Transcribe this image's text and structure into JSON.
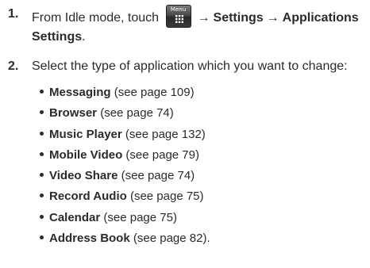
{
  "steps": [
    {
      "number": "1.",
      "prefix": "From Idle mode, touch",
      "menu_key_label": "Menu",
      "arrow": "→",
      "path": [
        "Settings",
        "Applications Settings"
      ],
      "suffix": "."
    },
    {
      "number": "2.",
      "text": "Select the type of application which you want to change:"
    }
  ],
  "applications": [
    {
      "name": "Messaging",
      "ref": "(see page 109)",
      "end": ""
    },
    {
      "name": "Browser",
      "ref": "(see page 74)",
      "end": ""
    },
    {
      "name": "Music Player",
      "ref": "(see page 132)",
      "end": ""
    },
    {
      "name": "Mobile Video",
      "ref": "(see page 79)",
      "end": ""
    },
    {
      "name": "Video Share",
      "ref": "(see page 74)",
      "end": ""
    },
    {
      "name": "Record Audio",
      "ref": "(see page 75)",
      "end": ""
    },
    {
      "name": "Calendar",
      "ref": "(see page 75)",
      "end": ""
    },
    {
      "name": "Address Book",
      "ref": "(see page 82)",
      "end": "."
    }
  ],
  "icons": {
    "menu_key": "menu-key-icon",
    "bullet": "bullet-icon"
  },
  "colors": {
    "text": "#2b2b2b",
    "menu_key": "#3a3a3a"
  }
}
